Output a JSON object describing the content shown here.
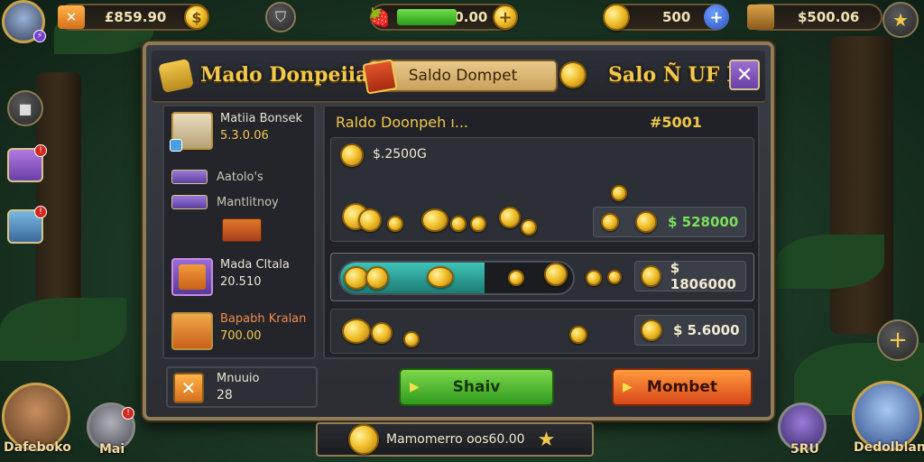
{
  "hud": {
    "gold_amount": "£859.90",
    "energy_amount": "10.00",
    "coins_amount": "500",
    "gems_amount": "$500.06"
  },
  "panel": {
    "title": "Mado Donpeiia",
    "tab_label": "Saldo Dompet",
    "right_title": "Salo Ñ UF R",
    "close_label": "✕"
  },
  "sidebar": {
    "items": [
      {
        "label": "Matiia Bonsek",
        "value": "5.3.0.06"
      },
      {
        "label": "Aatolo's"
      },
      {
        "label": "Mantlitnoy"
      },
      {
        "label": "Mada Cltala",
        "value": "20.510"
      },
      {
        "label": "Bapabh Kralan",
        "value": "700.00"
      }
    ]
  },
  "content": {
    "header_title": "Raldo Doonpeh ı...",
    "header_value": "#5001",
    "row1_value": "$.2500G",
    "row2_value": "$ 528000",
    "row3_value": "$ 1806000",
    "row4_value": "$ 5.6000",
    "progress_fraction": 0.62
  },
  "bottom": {
    "left_label": "Mnuuio",
    "left_value": "28",
    "green_button": "Shaiv",
    "orange_button": "Mombet"
  },
  "footer": {
    "banner_text": "Mamomerro oos60.00"
  },
  "avatars": {
    "left_name": "Dafeboko",
    "left2_name": "Mai",
    "right2_name": "5RU",
    "right_name": "Dedolblan"
  },
  "colors": {
    "accent_gold": "#f2c84b",
    "green_button": "#2f9a1e",
    "orange_button": "#d8481a",
    "value_green": "#7be05a"
  }
}
